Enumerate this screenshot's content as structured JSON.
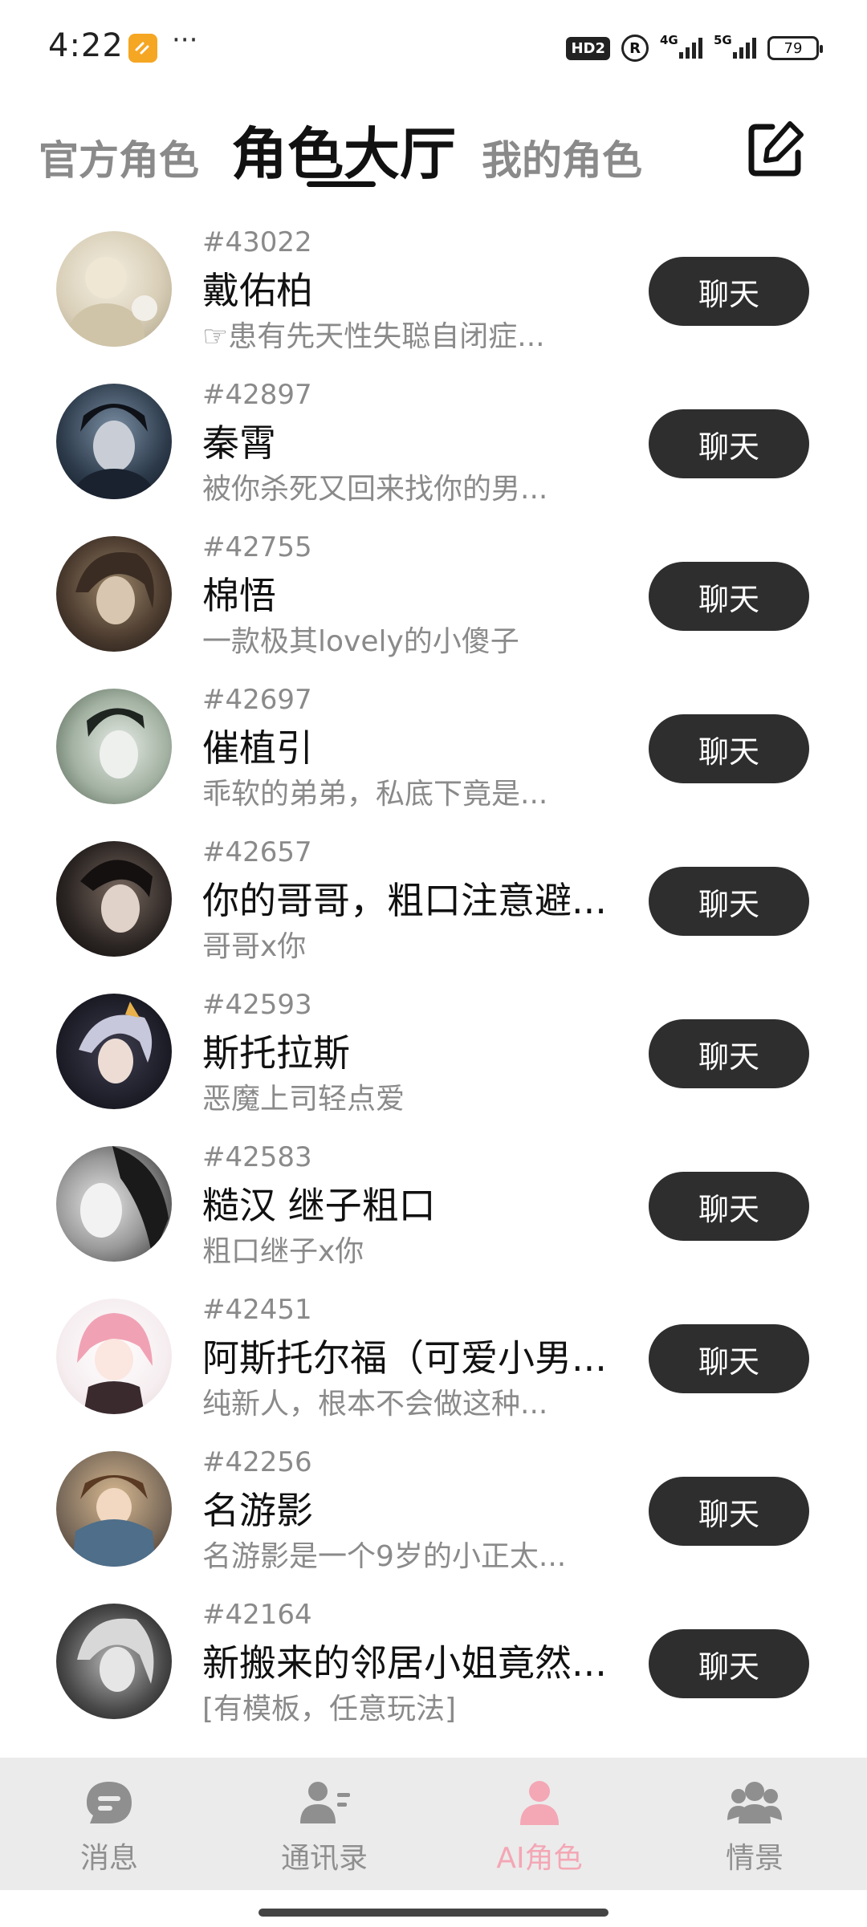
{
  "status_bar": {
    "time": "4:22",
    "dots": "···",
    "hd": "HD2",
    "r": "R",
    "net1": "4G",
    "net2": "5G",
    "battery": "79"
  },
  "tabs": {
    "official": "官方角色",
    "hall": "角色大厅",
    "mine": "我的角色"
  },
  "roles": [
    {
      "id": "#43022",
      "name": "戴佑柏",
      "desc": "☞患有先天性失聪自闭症...",
      "avatar_color": "#d9cfb8"
    },
    {
      "id": "#42897",
      "name": "秦霄",
      "desc": "被你杀死又回来找你的男...",
      "avatar_color": "#2c3a4a"
    },
    {
      "id": "#42755",
      "name": "棉悟",
      "desc": "一款极其lovely的小傻子",
      "avatar_color": "#4a3a2e"
    },
    {
      "id": "#42697",
      "name": "催植引",
      "desc": "乖软的弟弟，私底下竟是...",
      "avatar_color": "#6b7a6a"
    },
    {
      "id": "#42657",
      "name": "你的哥哥，粗口注意避...",
      "desc": "哥哥x你",
      "avatar_color": "#2a2422"
    },
    {
      "id": "#42593",
      "name": "斯托拉斯",
      "desc": "恶魔上司轻点爱",
      "avatar_color": "#3a3a4a"
    },
    {
      "id": "#42583",
      "name": "糙汉 继子粗口",
      "desc": "粗口继子x你",
      "avatar_color": "#5a5a5a"
    },
    {
      "id": "#42451",
      "name": "阿斯托尔福（可爱小男...",
      "desc": "纯新人，根本不会做这种...",
      "avatar_color": "#f2c6cf"
    },
    {
      "id": "#42256",
      "name": "名游影",
      "desc": "名游影是一个9岁的小正太...",
      "avatar_color": "#7a6a5a"
    },
    {
      "id": "#42164",
      "name": "新搬来的邻居小姐竟然...",
      "desc": "[有模板，任意玩法]",
      "avatar_color": "#3a3a3a"
    }
  ],
  "chat_label": "聊天",
  "nav": {
    "messages": "消息",
    "contacts": "通讯录",
    "ai_roles": "AI角色",
    "scenes": "情景"
  },
  "colors": {
    "chat_button": "#2e2e2e",
    "active_nav": "#f4a7b5",
    "inactive_nav": "#8f8f8f"
  }
}
